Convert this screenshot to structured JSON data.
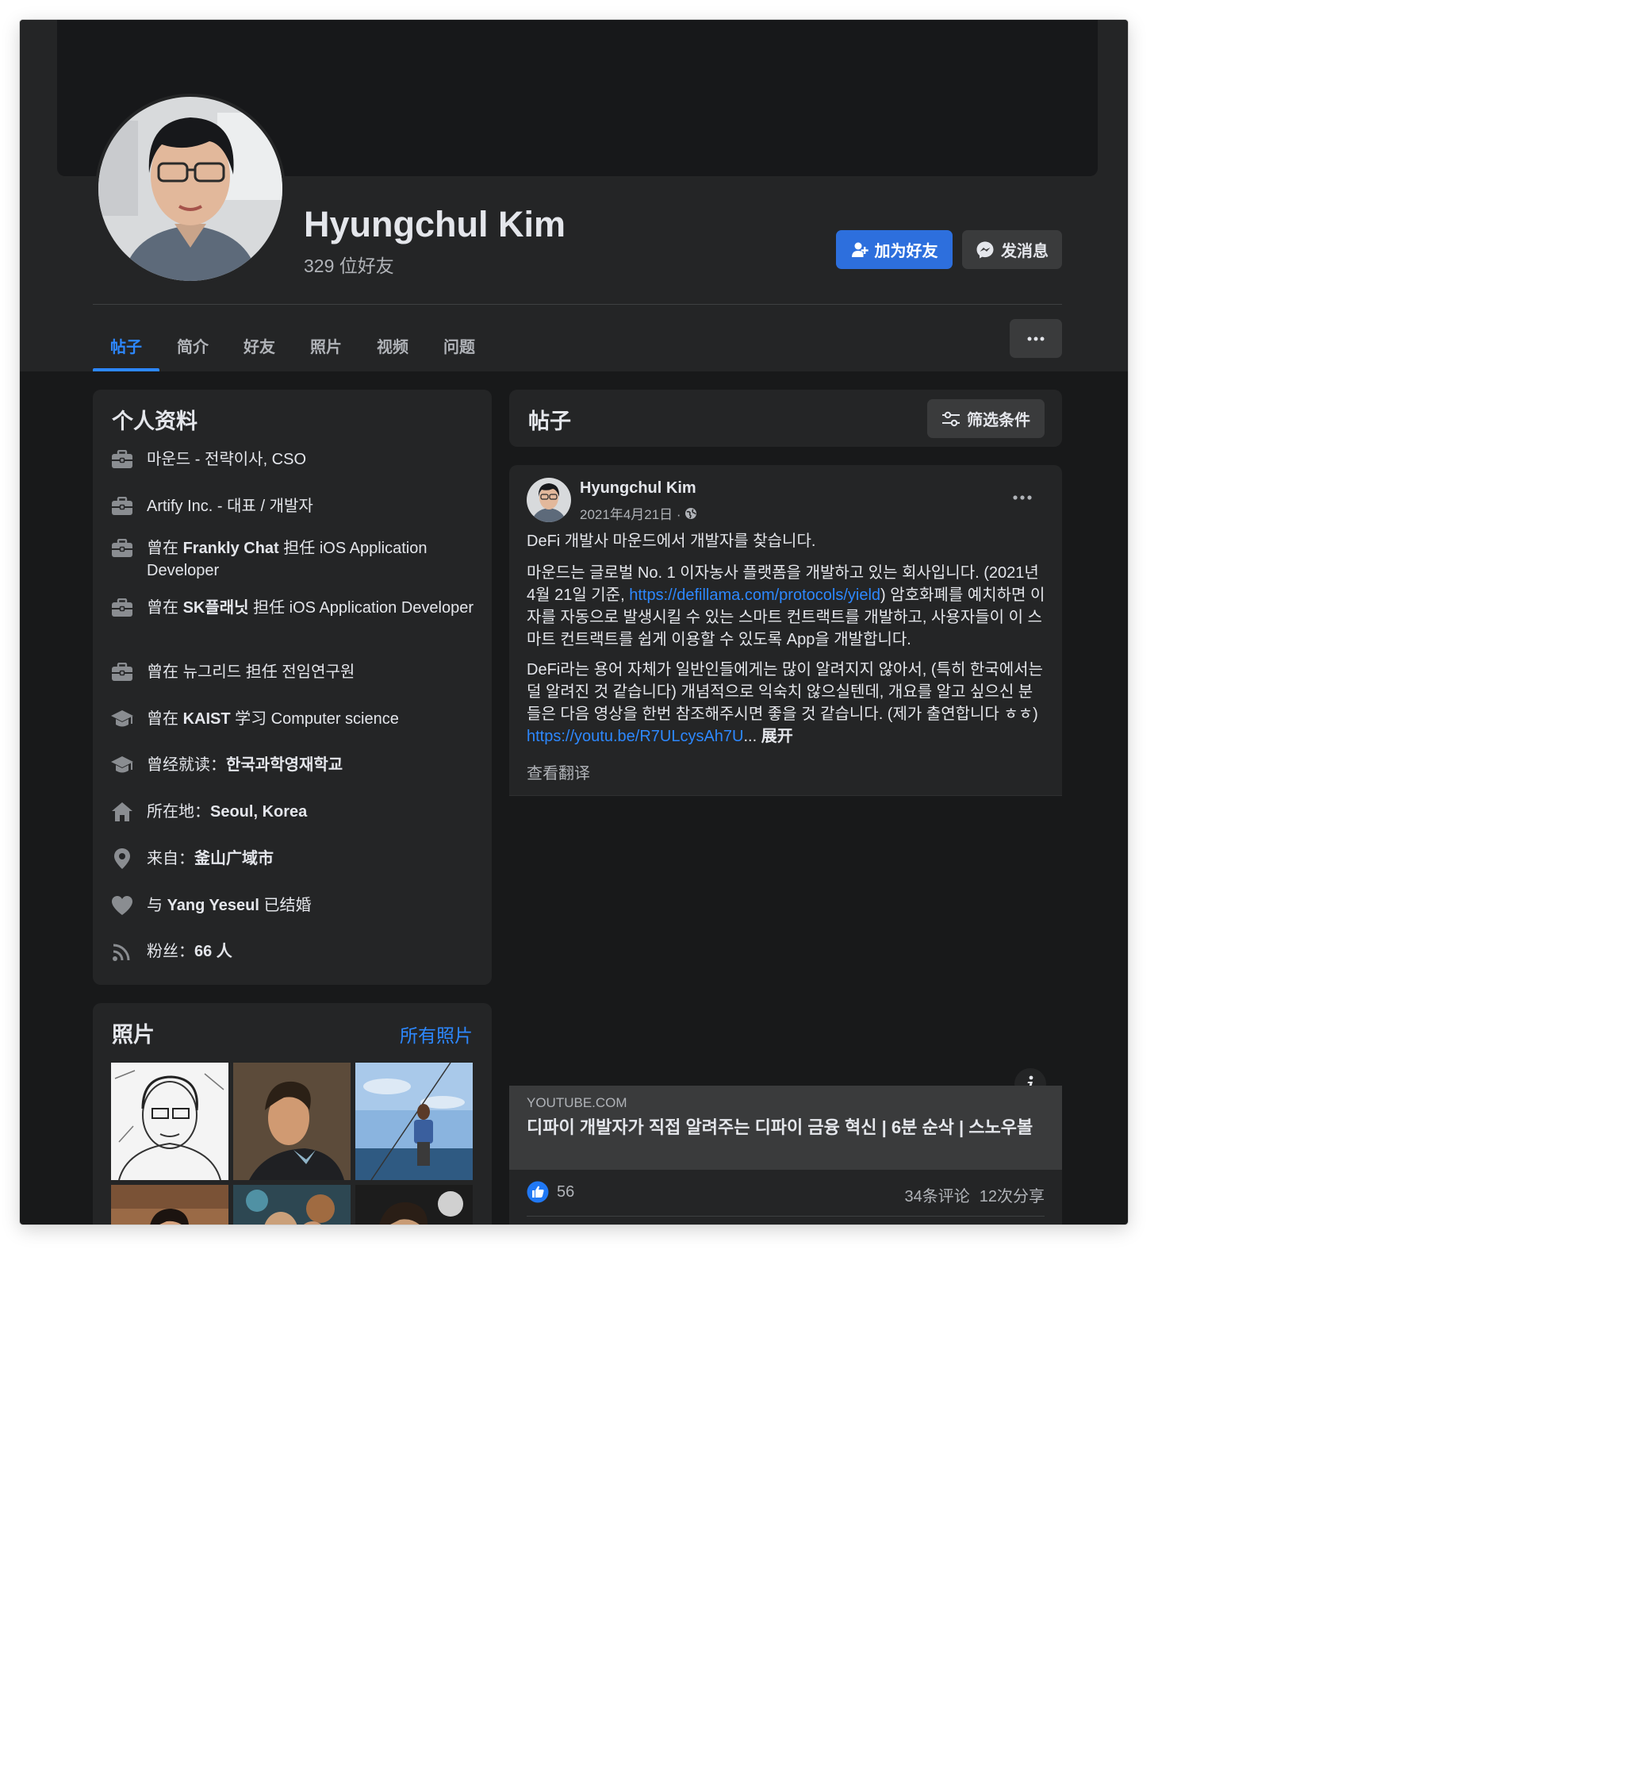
{
  "profile": {
    "name": "Hyungchul Kim",
    "friends_count": "329 位好友",
    "add_friend_label": "加为好友",
    "message_label": "发消息"
  },
  "tabs": [
    {
      "label": "帖子",
      "active": true
    },
    {
      "label": "简介"
    },
    {
      "label": "好友"
    },
    {
      "label": "照片"
    },
    {
      "label": "视频"
    },
    {
      "label": "问题"
    }
  ],
  "intro": {
    "title": "个人资料",
    "rows": [
      {
        "icon": "briefcase-icon",
        "text": "마운드 - 전략이사, CSO"
      },
      {
        "icon": "briefcase-icon",
        "text": "Artify Inc. - 대표 / 개발자"
      },
      {
        "icon": "briefcase-icon",
        "prefix": "曾在 ",
        "bold": "Frankly Chat",
        "suffix": " 担任 iOS Application Developer"
      },
      {
        "icon": "briefcase-icon",
        "prefix": "曾在 ",
        "bold": "SK플래닛",
        "suffix": " 担任 iOS Application Developer"
      },
      {
        "icon": "briefcase-icon",
        "prefix": "曾在 ",
        "bold": "뉴그리드",
        "suffix": " 担任 전임연구원"
      },
      {
        "icon": "graduation-cap-icon",
        "prefix": "曾在 ",
        "bold": "KAIST",
        "suffix": " 学习 Computer science"
      },
      {
        "icon": "graduation-cap-icon",
        "prefix": "曾经就读：",
        "bold": "한국과학영재학교",
        "suffix": ""
      },
      {
        "icon": "home-icon",
        "prefix": "所在地：",
        "bold": "Seoul, Korea",
        "suffix": ""
      },
      {
        "icon": "location-pin-icon",
        "prefix": "来自：",
        "bold": "釜山广域市",
        "suffix": ""
      },
      {
        "icon": "heart-icon",
        "prefix": "与 ",
        "bold": "Yang Yeseul",
        "suffix": " 已结婚"
      },
      {
        "icon": "rss-icon",
        "prefix": "粉丝：",
        "bold": "66 人",
        "suffix": ""
      }
    ]
  },
  "photos": {
    "title": "照片",
    "all_label": "所有照片"
  },
  "posts": {
    "title": "帖子",
    "filter_label": "筛选条件"
  },
  "post": {
    "author": "Hyungchul Kim",
    "date": "2021年4月21日 ·",
    "line1": "DeFi 개발사 마운드에서 개발자를 찾습니다.",
    "p2_before": "마운드는 글로벌 No. 1 이자농사 플랫폼을 개발하고 있는 회사입니다. (2021년 4월 21일 기준, ",
    "p2_link": "https://defillama.com/protocols/yield",
    "p2_after": ") 암호화폐를 예치하면 이자를 자동으로 발생시킬 수 있는 스마트 컨트랙트를 개발하고, 사용자들이 이 스마트 컨트랙트를 쉽게 이용할 수 있도록 App을 개발합니다.",
    "p3": "DeFi라는 용어 자체가 일반인들에게는 많이 알려지지 않아서, (특히 한국에서는 덜 알려진 것 같습니다) 개념적으로 익숙치 않으실텐데, 개요를 알고 싶으신 분들은 다음 영상을 한번 참조해주시면 좋을 것 같습니다. (제가 출연합니다 ㅎㅎ)",
    "p3_link": "https://youtu.be/R7ULcysAh7U",
    "ellipsis": "...",
    "expand_label": "展开",
    "see_translation": "查看翻译",
    "link_domain": "YOUTUBE.COM",
    "link_title": "디파이 개발자가 직접 알려주는 디파이 금융 혁신 | 6분 순삭 | 스노우볼",
    "likes": "56",
    "comments": "34条评论",
    "shares": "12次分享"
  },
  "colors": {
    "accent": "#2d88ff",
    "button_primary": "#2d6fdd",
    "card_bg": "#242526",
    "page_bg": "#18191a"
  }
}
